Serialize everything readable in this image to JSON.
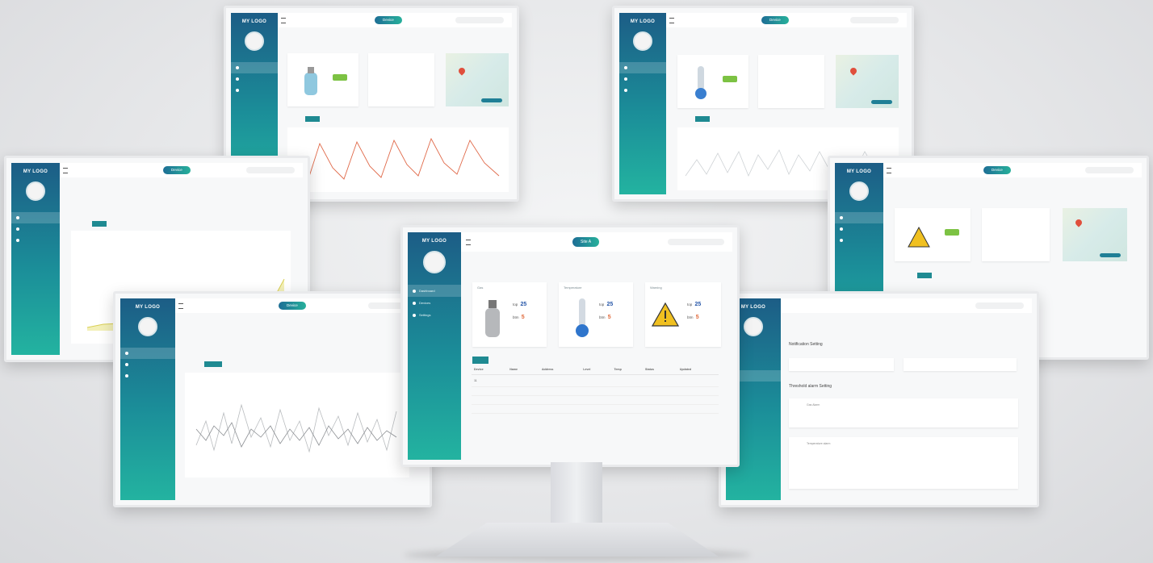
{
  "brand": {
    "logo_text": "MY LOGO",
    "accent": "#1f8a92",
    "sidebar_top": "#1c5d86",
    "sidebar_bottom": "#23b3a0"
  },
  "monitors": {
    "top_left": {
      "pill": "Device"
    },
    "top_right": {
      "pill": "Device"
    },
    "mid_left": {
      "pill": "Device"
    },
    "mid_right": {
      "pill": "Device"
    },
    "low_left": {
      "pill": "Device"
    },
    "low_right": {
      "pill": ""
    }
  },
  "center": {
    "pill": "Site A",
    "nav": [
      "Dashboard",
      "Devices",
      "Settings"
    ],
    "cards": [
      {
        "title": "Gas",
        "icon": "gas-cylinder-icon",
        "top": "25",
        "bottom": "5"
      },
      {
        "title": "Temperature",
        "icon": "thermometer-icon",
        "top": "25",
        "bottom": "5"
      },
      {
        "title": "Warning",
        "icon": "warning-sign-icon",
        "top": "25",
        "bottom": "5"
      }
    ],
    "table": {
      "headers": [
        "Device",
        "Name",
        "Address",
        "Level",
        "Temp",
        "Status",
        "Updated"
      ],
      "rows": [
        [
          "11",
          "",
          "",
          "",
          "",
          "",
          ""
        ],
        [
          "",
          "",
          "",
          "",
          "",
          "",
          ""
        ],
        [
          "",
          "",
          "",
          "",
          "",
          "",
          ""
        ],
        [
          "",
          "",
          "",
          "",
          "",
          "",
          ""
        ]
      ]
    }
  },
  "notifications": {
    "section1": "Notification Setting",
    "section2": "Threshold alarm Setting",
    "item1": "Gas Alarm",
    "item2": "Temperature alarm"
  }
}
